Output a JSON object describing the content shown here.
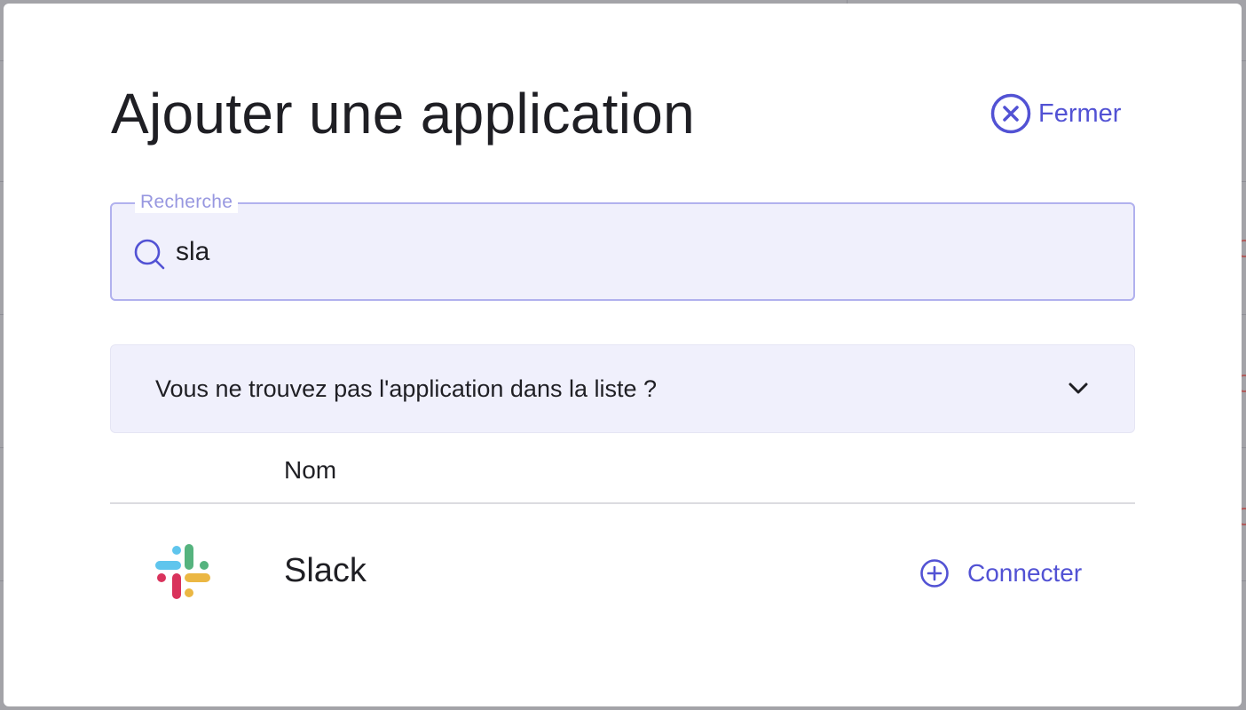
{
  "modal": {
    "title": "Ajouter une application",
    "close_label": "Fermer"
  },
  "search": {
    "label": "Recherche",
    "value": "sla"
  },
  "accordion": {
    "label": "Vous ne trouvez pas l'application dans la liste ?",
    "expanded": false
  },
  "table": {
    "columns": [
      {
        "label": "Nom"
      }
    ],
    "rows": [
      {
        "name": "Slack",
        "logo": "slack-logo",
        "action_label": "Connecter"
      }
    ]
  },
  "colors": {
    "accent": "#5252d4",
    "field_background": "#f0f0fc",
    "field_border": "#b1b1ee",
    "text": "#1f1f24"
  },
  "icons": {
    "close": "close-circle-icon",
    "search": "search-icon",
    "accordion": "chevron-down-icon",
    "connect": "plus-circle-icon"
  }
}
